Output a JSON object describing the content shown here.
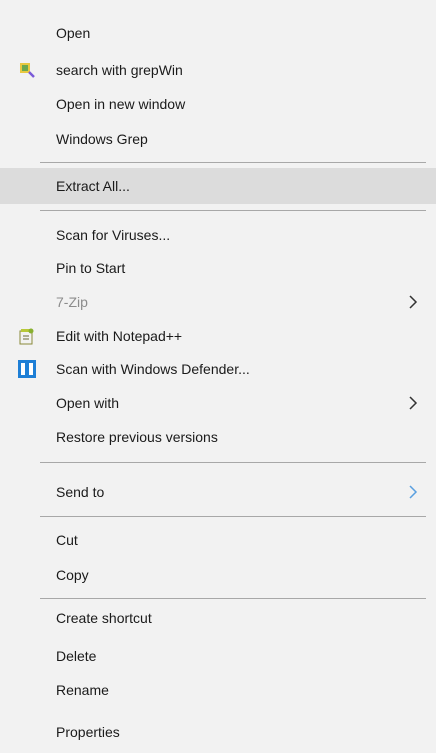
{
  "menu": {
    "items": [
      {
        "label": "Open"
      },
      {
        "label": "search with grepWin",
        "icon": "grepwin-icon"
      },
      {
        "label": "Open in new window"
      },
      {
        "label": "Windows Grep"
      },
      {
        "label": "Extract All..."
      },
      {
        "label": "Scan for Viruses..."
      },
      {
        "label": "Pin to Start"
      },
      {
        "label": "7-Zip",
        "submenu": true
      },
      {
        "label": "Edit with Notepad++",
        "icon": "notepadpp-icon"
      },
      {
        "label": "Scan with Windows Defender...",
        "icon": "windows-defender-icon"
      },
      {
        "label": "Open with",
        "submenu": true
      },
      {
        "label": "Restore previous versions"
      },
      {
        "label": "Send to",
        "submenu": true
      },
      {
        "label": "Cut"
      },
      {
        "label": "Copy"
      },
      {
        "label": "Create shortcut"
      },
      {
        "label": "Delete"
      },
      {
        "label": "Rename"
      },
      {
        "label": "Properties"
      }
    ]
  }
}
